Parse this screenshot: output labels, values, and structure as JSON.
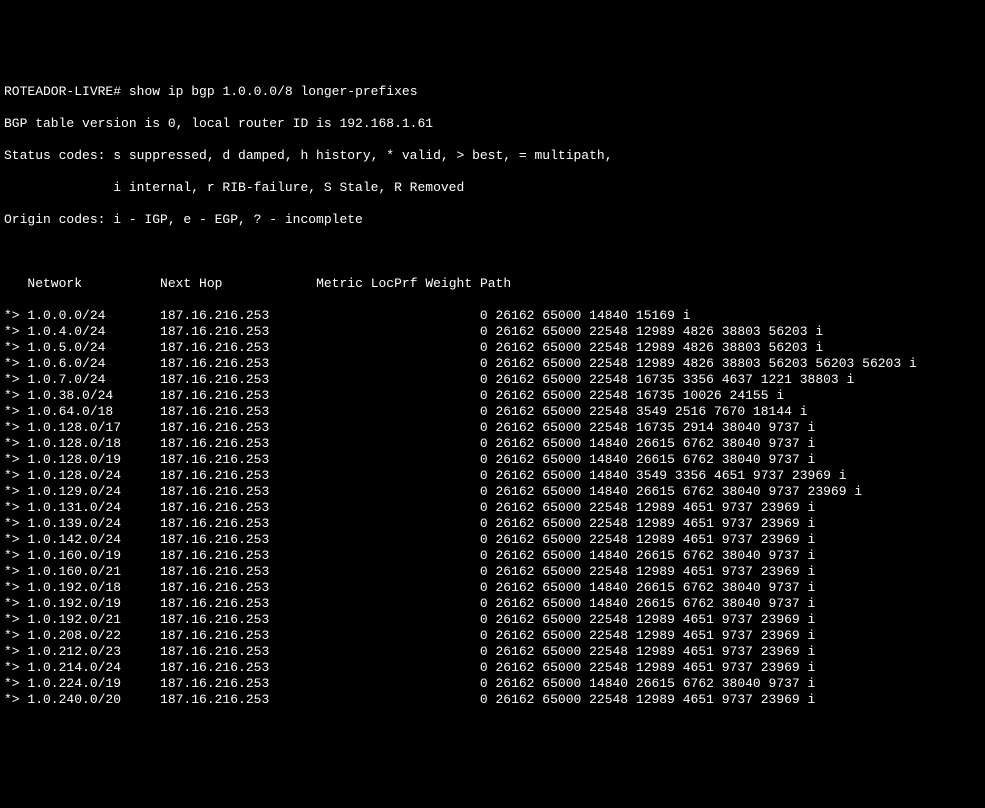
{
  "prompt": {
    "hostname": "ROTEADOR-LIVRE#",
    "command": "show ip bgp 1.0.0.0/8 longer-prefixes"
  },
  "header": {
    "line1": "BGP table version is 0, local router ID is 192.168.1.61",
    "line2": "Status codes: s suppressed, d damped, h history, * valid, > best, = multipath,",
    "line3": "              i internal, r RIB-failure, S Stale, R Removed",
    "line4": "Origin codes: i - IGP, e - EGP, ? - incomplete"
  },
  "columns": {
    "network": "Network",
    "nexthop": "Next Hop",
    "metric": "Metric",
    "locprf": "LocPrf",
    "weight": "Weight",
    "path": "Path"
  },
  "routes": [
    {
      "status": "*>",
      "network": "1.0.0.0/24",
      "nexthop": "187.16.216.253",
      "weight": "0",
      "path": "26162 65000 14840 15169 i"
    },
    {
      "status": "*>",
      "network": "1.0.4.0/24",
      "nexthop": "187.16.216.253",
      "weight": "0",
      "path": "26162 65000 22548 12989 4826 38803 56203 i"
    },
    {
      "status": "*>",
      "network": "1.0.5.0/24",
      "nexthop": "187.16.216.253",
      "weight": "0",
      "path": "26162 65000 22548 12989 4826 38803 56203 i"
    },
    {
      "status": "*>",
      "network": "1.0.6.0/24",
      "nexthop": "187.16.216.253",
      "weight": "0",
      "path": "26162 65000 22548 12989 4826 38803 56203 56203 56203 i"
    },
    {
      "status": "*>",
      "network": "1.0.7.0/24",
      "nexthop": "187.16.216.253",
      "weight": "0",
      "path": "26162 65000 22548 16735 3356 4637 1221 38803 i"
    },
    {
      "status": "*>",
      "network": "1.0.38.0/24",
      "nexthop": "187.16.216.253",
      "weight": "0",
      "path": "26162 65000 22548 16735 10026 24155 i"
    },
    {
      "status": "*>",
      "network": "1.0.64.0/18",
      "nexthop": "187.16.216.253",
      "weight": "0",
      "path": "26162 65000 22548 3549 2516 7670 18144 i"
    },
    {
      "status": "*>",
      "network": "1.0.128.0/17",
      "nexthop": "187.16.216.253",
      "weight": "0",
      "path": "26162 65000 22548 16735 2914 38040 9737 i"
    },
    {
      "status": "*>",
      "network": "1.0.128.0/18",
      "nexthop": "187.16.216.253",
      "weight": "0",
      "path": "26162 65000 14840 26615 6762 38040 9737 i"
    },
    {
      "status": "*>",
      "network": "1.0.128.0/19",
      "nexthop": "187.16.216.253",
      "weight": "0",
      "path": "26162 65000 14840 26615 6762 38040 9737 i"
    },
    {
      "status": "*>",
      "network": "1.0.128.0/24",
      "nexthop": "187.16.216.253",
      "weight": "0",
      "path": "26162 65000 14840 3549 3356 4651 9737 23969 i"
    },
    {
      "status": "*>",
      "network": "1.0.129.0/24",
      "nexthop": "187.16.216.253",
      "weight": "0",
      "path": "26162 65000 14840 26615 6762 38040 9737 23969 i"
    },
    {
      "status": "*>",
      "network": "1.0.131.0/24",
      "nexthop": "187.16.216.253",
      "weight": "0",
      "path": "26162 65000 22548 12989 4651 9737 23969 i"
    },
    {
      "status": "*>",
      "network": "1.0.139.0/24",
      "nexthop": "187.16.216.253",
      "weight": "0",
      "path": "26162 65000 22548 12989 4651 9737 23969 i"
    },
    {
      "status": "*>",
      "network": "1.0.142.0/24",
      "nexthop": "187.16.216.253",
      "weight": "0",
      "path": "26162 65000 22548 12989 4651 9737 23969 i"
    },
    {
      "status": "*>",
      "network": "1.0.160.0/19",
      "nexthop": "187.16.216.253",
      "weight": "0",
      "path": "26162 65000 14840 26615 6762 38040 9737 i"
    },
    {
      "status": "*>",
      "network": "1.0.160.0/21",
      "nexthop": "187.16.216.253",
      "weight": "0",
      "path": "26162 65000 22548 12989 4651 9737 23969 i"
    },
    {
      "status": "*>",
      "network": "1.0.192.0/18",
      "nexthop": "187.16.216.253",
      "weight": "0",
      "path": "26162 65000 14840 26615 6762 38040 9737 i"
    },
    {
      "status": "*>",
      "network": "1.0.192.0/19",
      "nexthop": "187.16.216.253",
      "weight": "0",
      "path": "26162 65000 14840 26615 6762 38040 9737 i"
    },
    {
      "status": "*>",
      "network": "1.0.192.0/21",
      "nexthop": "187.16.216.253",
      "weight": "0",
      "path": "26162 65000 22548 12989 4651 9737 23969 i"
    },
    {
      "status": "*>",
      "network": "1.0.208.0/22",
      "nexthop": "187.16.216.253",
      "weight": "0",
      "path": "26162 65000 22548 12989 4651 9737 23969 i"
    },
    {
      "status": "*>",
      "network": "1.0.212.0/23",
      "nexthop": "187.16.216.253",
      "weight": "0",
      "path": "26162 65000 22548 12989 4651 9737 23969 i"
    },
    {
      "status": "*>",
      "network": "1.0.214.0/24",
      "nexthop": "187.16.216.253",
      "weight": "0",
      "path": "26162 65000 22548 12989 4651 9737 23969 i"
    },
    {
      "status": "*>",
      "network": "1.0.224.0/19",
      "nexthop": "187.16.216.253",
      "weight": "0",
      "path": "26162 65000 14840 26615 6762 38040 9737 i"
    },
    {
      "status": "*>",
      "network": "1.0.240.0/20",
      "nexthop": "187.16.216.253",
      "weight": "0",
      "path": "26162 65000 22548 12989 4651 9737 23969 i"
    }
  ]
}
